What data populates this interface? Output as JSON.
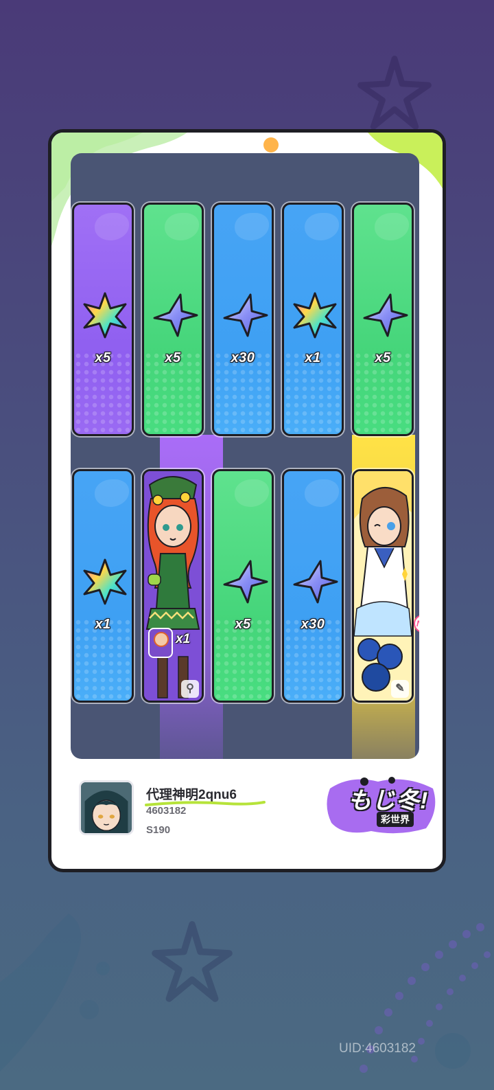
{
  "tiles": [
    {
      "row": 1,
      "col": 1,
      "bg": "purple",
      "item": "prism-crystal-icon",
      "qty": "x5"
    },
    {
      "row": 1,
      "col": 2,
      "bg": "green",
      "item": "star-crystal-icon",
      "qty": "x5"
    },
    {
      "row": 1,
      "col": 3,
      "bg": "blue",
      "item": "star-crystal-icon",
      "qty": "x30"
    },
    {
      "row": 1,
      "col": 4,
      "bg": "blue",
      "item": "prism-crystal-icon",
      "qty": "x1"
    },
    {
      "row": 1,
      "col": 5,
      "bg": "green",
      "item": "star-crystal-icon",
      "qty": "x5"
    },
    {
      "row": 2,
      "col": 1,
      "bg": "blue",
      "item": "prism-crystal-icon",
      "qty": "x1"
    },
    {
      "row": 2,
      "col": 2,
      "bg": "purple",
      "item": "character-card",
      "qty": "x1"
    },
    {
      "row": 2,
      "col": 3,
      "bg": "green",
      "item": "star-crystal-icon",
      "qty": "x5"
    },
    {
      "row": 2,
      "col": 4,
      "bg": "blue",
      "item": "star-crystal-icon",
      "qty": "x30"
    },
    {
      "row": 2,
      "col": 5,
      "bg": "gold",
      "item": "character-card",
      "qty": ""
    }
  ],
  "new_badge": "NEW",
  "profile": {
    "nickname": "代理神明2qnu6",
    "uid": "4603182",
    "server": "S190"
  },
  "logo": {
    "text": "もじ冬!",
    "sub": "彩世界"
  },
  "footer_uid": "UID:4603182",
  "colors": {
    "blue": "#3ea0f3",
    "green": "#45d57a",
    "purple": "#8f5ff0",
    "gold": "#ffd53c",
    "frame": "#1e1e24"
  }
}
